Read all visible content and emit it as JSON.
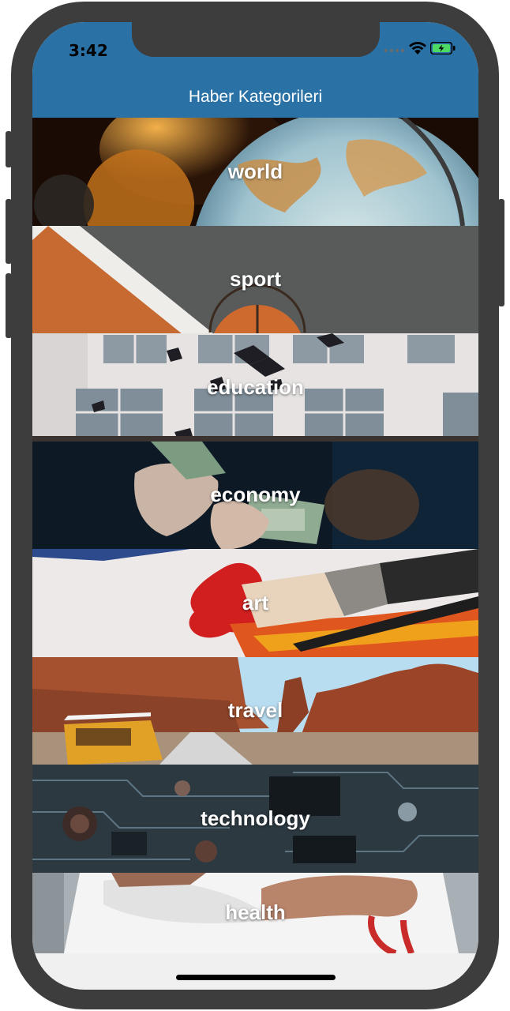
{
  "status_bar": {
    "time": "3:42"
  },
  "header": {
    "title": "Haber Kategorileri"
  },
  "categories": [
    {
      "label": "world",
      "image": "globe"
    },
    {
      "label": "sport",
      "image": "basketball-court"
    },
    {
      "label": "education",
      "image": "graduation-caps"
    },
    {
      "label": "economy",
      "image": "money-hands"
    },
    {
      "label": "art",
      "image": "paintbrush"
    },
    {
      "label": "travel",
      "image": "desert-van"
    },
    {
      "label": "technology",
      "image": "circuit-board"
    },
    {
      "label": "health",
      "image": "doctor-stethoscope"
    }
  ],
  "colors": {
    "nav_bar": "#2a71a6",
    "phone_frame": "#3d3d3d",
    "screen_bg": "#f0f0f0"
  }
}
